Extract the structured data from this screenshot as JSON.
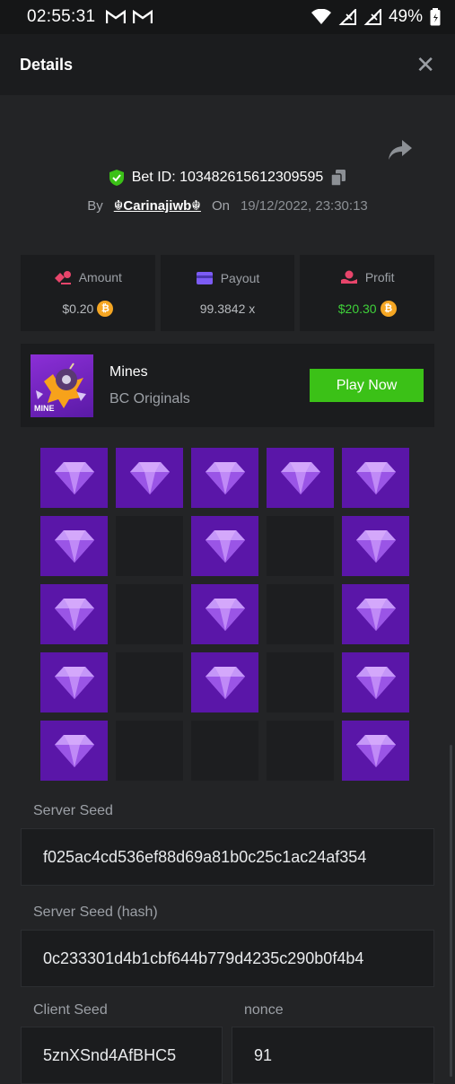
{
  "status_bar": {
    "time": "02:55:31",
    "battery": "49%"
  },
  "header": {
    "title": "Details",
    "close": "✕"
  },
  "bet": {
    "id_label": "Bet ID: 103482615612309595",
    "by_label": "By",
    "user": "☬Carinajiwb☬",
    "on_label": "On",
    "date": "19/12/2022, 23:30:13"
  },
  "stats": {
    "amount_label": "Amount",
    "amount_value": "$0.20",
    "payout_label": "Payout",
    "payout_value": "99.3842 x",
    "profit_label": "Profit",
    "profit_value": "$20.30"
  },
  "game": {
    "thumb_text": "MINE",
    "name": "Mines",
    "provider": "BC Originals",
    "play_label": "Play Now"
  },
  "board": {
    "rows": [
      [
        1,
        1,
        1,
        1,
        1
      ],
      [
        1,
        0,
        1,
        0,
        1
      ],
      [
        1,
        0,
        1,
        0,
        1
      ],
      [
        1,
        0,
        1,
        0,
        1
      ],
      [
        1,
        0,
        0,
        0,
        1
      ]
    ]
  },
  "seeds": {
    "server_seed_label": "Server Seed",
    "server_seed_value": "f025ac4cd536ef88d69a81b0c25c1ac24af354",
    "server_hash_label": "Server Seed (hash)",
    "server_hash_value": "0c233301d4b1cbf644b779d4235c290b0f4b4",
    "client_seed_label": "Client Seed",
    "client_seed_value": "5znXSnd4AfBHC5",
    "nonce_label": "nonce",
    "nonce_value": "91"
  },
  "colors": {
    "accent_green": "#3bc117",
    "gem_tile": "#5a16a8",
    "coin": "#f5a623"
  }
}
